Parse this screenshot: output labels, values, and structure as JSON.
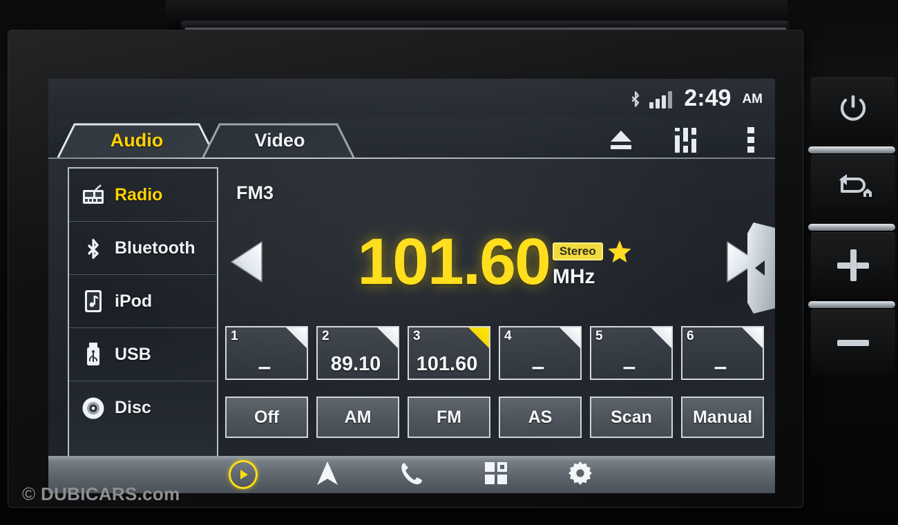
{
  "device": {
    "watermark_symbol": "©",
    "watermark": "DUBICARS.com"
  },
  "status_bar": {
    "bluetooth_icon": "bluetooth-icon",
    "signal_icon": "signal-bars-icon",
    "time": "2:49",
    "meridiem": "AM"
  },
  "tabs": [
    {
      "label": "Audio",
      "active": true
    },
    {
      "label": "Video",
      "active": false
    }
  ],
  "tab_icons": [
    {
      "name": "eject-icon"
    },
    {
      "name": "equalizer-icon"
    },
    {
      "name": "more-options-icon"
    }
  ],
  "sources": [
    {
      "label": "Radio",
      "icon": "radio-icon",
      "active": true
    },
    {
      "label": "Bluetooth",
      "icon": "bluetooth-icon",
      "active": false
    },
    {
      "label": "iPod",
      "icon": "ipod-icon",
      "active": false
    },
    {
      "label": "USB",
      "icon": "usb-icon",
      "active": false
    },
    {
      "label": "Disc",
      "icon": "disc-icon",
      "active": false
    }
  ],
  "tuner": {
    "band": "FM3",
    "frequency": "101.60",
    "unit": "MHz",
    "stereo_label": "Stereo",
    "favorite_icon": "star-icon",
    "seek_down_icon": "seek-down-icon",
    "seek_up_icon": "seek-up-icon",
    "panel_handle_icon": "collapse-panel-icon"
  },
  "presets": [
    {
      "number": "1",
      "value": "–",
      "empty": true,
      "active": false
    },
    {
      "number": "2",
      "value": "89.10",
      "empty": false,
      "active": false
    },
    {
      "number": "3",
      "value": "101.60",
      "empty": false,
      "active": true
    },
    {
      "number": "4",
      "value": "–",
      "empty": true,
      "active": false
    },
    {
      "number": "5",
      "value": "–",
      "empty": true,
      "active": false
    },
    {
      "number": "6",
      "value": "–",
      "empty": true,
      "active": false
    }
  ],
  "function_buttons": [
    {
      "label": "Off"
    },
    {
      "label": "AM"
    },
    {
      "label": "FM"
    },
    {
      "label": "AS"
    },
    {
      "label": "Scan"
    },
    {
      "label": "Manual"
    }
  ],
  "nav_bar": [
    {
      "name": "media-play-nav",
      "icon": "play-circle-icon",
      "active": true
    },
    {
      "name": "navigation-nav",
      "icon": "navigation-arrow-icon",
      "active": false
    },
    {
      "name": "phone-nav",
      "icon": "phone-icon",
      "active": false
    },
    {
      "name": "apps-nav",
      "icon": "apps-grid-icon",
      "active": false
    },
    {
      "name": "settings-nav",
      "icon": "gear-icon",
      "active": false
    }
  ],
  "hard_keys": [
    {
      "name": "power-key",
      "icon": "power-icon"
    },
    {
      "name": "back-home-key",
      "icon": "back-home-icon"
    },
    {
      "name": "volume-up-key",
      "icon": "plus-icon"
    },
    {
      "name": "volume-down-key",
      "icon": "minus-icon"
    }
  ],
  "colors": {
    "accent_yellow": "#ffd400",
    "frequency_yellow": "#ffdd14",
    "text_white": "#f2f5f7",
    "screen_bg": "#262b32"
  }
}
